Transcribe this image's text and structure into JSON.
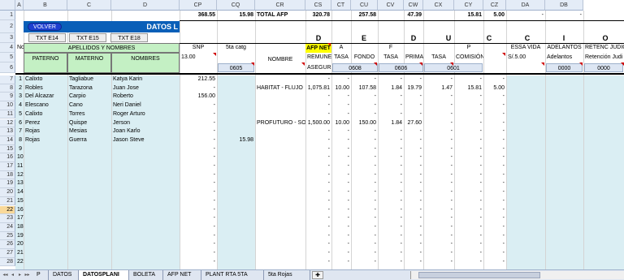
{
  "columns": [
    "A",
    "B",
    "C",
    "D",
    "CP",
    "CQ",
    "CR",
    "CS",
    "CT",
    "CU",
    "CV",
    "CW",
    "CX",
    "CY",
    "CZ",
    "DA",
    "DB"
  ],
  "row1": {
    "cp": "368.55",
    "cq": "15.98",
    "cr": "TOTAL AFP",
    "cs": "320.78",
    "cu": "257.58",
    "cw": "47.39",
    "cy": "15.81",
    "cz": "5.00",
    "da": "-",
    "db": "-"
  },
  "row2": {
    "volver": "VOLVER",
    "datos": "DATOS L"
  },
  "row3": {
    "txt14": "TXT E14",
    "txt15": "TXT E15",
    "txt18": "TXT E18",
    "letters": [
      "D",
      "E",
      "D",
      "U",
      "C",
      "C",
      "I",
      "O"
    ]
  },
  "row4": {
    "no": "No",
    "apellidos": "APELLIDOS Y NOMBRES",
    "snp": "SNP",
    "catg": "5ta catg",
    "afpnet": "AFP NET",
    "a": "A",
    "f": "F",
    "p": "P",
    "essa": "ESSA VIDA",
    "adel": "ADELANTOS",
    "reten": "RETENC JUDIC"
  },
  "row5": {
    "paterno": "PATERNO",
    "materno": "MATERNO",
    "nombres": "NOMBRES",
    "snpval": "13.00",
    "nombre": "NOMBRE",
    "remuner": "REMUNER",
    "tasa1": "TASA",
    "fondo": "FONDO",
    "tasa2": "TASA",
    "prima": "PRIMA",
    "tasa3": "TASA",
    "comision": "COMISIÓN",
    "essaval": "S/.5.00",
    "adelantos": "Adelantos",
    "retencion": "Retención Judi"
  },
  "row6": {
    "cq": "0605",
    "asegur": "ASEGUR",
    "cu": "0608",
    "cw": "0606",
    "cy": "0601",
    "da": "0000",
    "db": "0000"
  },
  "rows": [
    {
      "n": "1",
      "pat": "Calixto",
      "mat": "Tagliabue",
      "nom": "Katya Karin",
      "snp": "212.55",
      "catg": "",
      "afp": "",
      "rem": "-",
      "t1": "-",
      "fon": "-",
      "t2": "-",
      "pri": "-",
      "t3": "-",
      "com": "-",
      "ess": "-"
    },
    {
      "n": "2",
      "pat": "Robles",
      "mat": "Tarazona",
      "nom": "Juan Jose",
      "snp": "-",
      "catg": "",
      "afp": "HABITAT - FLUJO",
      "rem": "1,075.81",
      "t1": "10.00",
      "fon": "107.58",
      "t2": "1.84",
      "pri": "19.79",
      "t3": "1.47",
      "com": "15.81",
      "ess": "5.00"
    },
    {
      "n": "3",
      "pat": "Del Alcazar",
      "mat": "Carpio",
      "nom": "Roberto",
      "snp": "156.00",
      "catg": "",
      "afp": "",
      "rem": "-",
      "t1": "-",
      "fon": "-",
      "t2": "-",
      "pri": "-",
      "t3": "-",
      "com": "-",
      "ess": "-"
    },
    {
      "n": "4",
      "pat": "Elescano",
      "mat": "Cano",
      "nom": "Neri Daniel",
      "snp": "-",
      "catg": "",
      "afp": "",
      "rem": "-",
      "t1": "-",
      "fon": "-",
      "t2": "-",
      "pri": "-",
      "t3": "-",
      "com": "-",
      "ess": "-"
    },
    {
      "n": "5",
      "pat": "Calixto",
      "mat": "Torres",
      "nom": "Roger Arturo",
      "snp": "-",
      "catg": "",
      "afp": "",
      "rem": "-",
      "t1": "-",
      "fon": "-",
      "t2": "-",
      "pri": "-",
      "t3": "-",
      "com": "-",
      "ess": "-"
    },
    {
      "n": "6",
      "pat": "Perez",
      "mat": "Quispe",
      "nom": "Jerson",
      "snp": "-",
      "catg": "",
      "afp": "PROFUTURO - SOB",
      "rem": "1,500.00",
      "t1": "10.00",
      "fon": "150.00",
      "t2": "1.84",
      "pri": "27.60",
      "t3": "-",
      "com": "-",
      "ess": "-"
    },
    {
      "n": "7",
      "pat": "Rojas",
      "mat": "Mesias",
      "nom": "Joan Karlo",
      "snp": "-",
      "catg": "",
      "afp": "",
      "rem": "-",
      "t1": "-",
      "fon": "-",
      "t2": "-",
      "pri": "-",
      "t3": "-",
      "com": "-",
      "ess": "-"
    },
    {
      "n": "8",
      "pat": "Rojas",
      "mat": "Guerra",
      "nom": "Jason Steve",
      "snp": "-",
      "catg": "15.98",
      "afp": "",
      "rem": "-",
      "t1": "-",
      "fon": "-",
      "t2": "-",
      "pri": "-",
      "t3": "-",
      "com": "-",
      "ess": "-"
    },
    {
      "n": "9",
      "pat": "",
      "mat": "",
      "nom": "",
      "snp": "-",
      "catg": "",
      "afp": "",
      "rem": "-",
      "t1": "-",
      "fon": "-",
      "t2": "-",
      "pri": "-",
      "t3": "-",
      "com": "-",
      "ess": "-"
    },
    {
      "n": "10",
      "pat": "",
      "mat": "",
      "nom": "",
      "snp": "-",
      "catg": "",
      "afp": "",
      "rem": "-",
      "t1": "-",
      "fon": "-",
      "t2": "-",
      "pri": "-",
      "t3": "-",
      "com": "-",
      "ess": "-"
    },
    {
      "n": "11",
      "pat": "",
      "mat": "",
      "nom": "",
      "snp": "-",
      "catg": "",
      "afp": "",
      "rem": "-",
      "t1": "-",
      "fon": "-",
      "t2": "-",
      "pri": "-",
      "t3": "-",
      "com": "-",
      "ess": "-"
    },
    {
      "n": "12",
      "pat": "",
      "mat": "",
      "nom": "",
      "snp": "-",
      "catg": "",
      "afp": "",
      "rem": "-",
      "t1": "-",
      "fon": "-",
      "t2": "-",
      "pri": "-",
      "t3": "-",
      "com": "-",
      "ess": "-"
    },
    {
      "n": "13",
      "pat": "",
      "mat": "",
      "nom": "",
      "snp": "-",
      "catg": "",
      "afp": "",
      "rem": "-",
      "t1": "-",
      "fon": "-",
      "t2": "-",
      "pri": "-",
      "t3": "-",
      "com": "-",
      "ess": "-"
    },
    {
      "n": "14",
      "pat": "",
      "mat": "",
      "nom": "",
      "snp": "-",
      "catg": "",
      "afp": "",
      "rem": "-",
      "t1": "-",
      "fon": "-",
      "t2": "-",
      "pri": "-",
      "t3": "-",
      "com": "-",
      "ess": "-"
    },
    {
      "n": "15",
      "pat": "",
      "mat": "",
      "nom": "",
      "snp": "-",
      "catg": "",
      "afp": "",
      "rem": "-",
      "t1": "-",
      "fon": "-",
      "t2": "-",
      "pri": "-",
      "t3": "-",
      "com": "-",
      "ess": "-"
    },
    {
      "n": "16",
      "pat": "",
      "mat": "",
      "nom": "",
      "snp": "-",
      "catg": "",
      "afp": "",
      "rem": "-",
      "t1": "-",
      "fon": "-",
      "t2": "-",
      "pri": "-",
      "t3": "-",
      "com": "-",
      "ess": "-"
    },
    {
      "n": "17",
      "pat": "",
      "mat": "",
      "nom": "",
      "snp": "-",
      "catg": "",
      "afp": "",
      "rem": "-",
      "t1": "-",
      "fon": "-",
      "t2": "-",
      "pri": "-",
      "t3": "-",
      "com": "-",
      "ess": "-"
    },
    {
      "n": "18",
      "pat": "",
      "mat": "",
      "nom": "",
      "snp": "-",
      "catg": "",
      "afp": "",
      "rem": "-",
      "t1": "-",
      "fon": "-",
      "t2": "-",
      "pri": "-",
      "t3": "-",
      "com": "-",
      "ess": "-"
    },
    {
      "n": "19",
      "pat": "",
      "mat": "",
      "nom": "",
      "snp": "-",
      "catg": "",
      "afp": "",
      "rem": "-",
      "t1": "-",
      "fon": "-",
      "t2": "-",
      "pri": "-",
      "t3": "-",
      "com": "-",
      "ess": "-"
    },
    {
      "n": "20",
      "pat": "",
      "mat": "",
      "nom": "",
      "snp": "-",
      "catg": "",
      "afp": "",
      "rem": "-",
      "t1": "-",
      "fon": "-",
      "t2": "-",
      "pri": "-",
      "t3": "-",
      "com": "-",
      "ess": "-"
    },
    {
      "n": "21",
      "pat": "",
      "mat": "",
      "nom": "",
      "snp": "-",
      "catg": "",
      "afp": "",
      "rem": "-",
      "t1": "-",
      "fon": "-",
      "t2": "-",
      "pri": "-",
      "t3": "-",
      "com": "-",
      "ess": "-"
    },
    {
      "n": "22",
      "pat": "",
      "mat": "",
      "nom": "",
      "snp": "-",
      "catg": "",
      "afp": "",
      "rem": "-",
      "t1": "-",
      "fon": "-",
      "t2": "-",
      "pri": "-",
      "t3": "-",
      "com": "-",
      "ess": "-"
    }
  ],
  "row_headers": [
    "1",
    "2",
    "3",
    "4",
    "5",
    "6",
    "7",
    "8",
    "9",
    "10",
    "11",
    "12",
    "13",
    "14",
    "15",
    "16",
    "17",
    "18",
    "19",
    "20",
    "21",
    "22",
    "23",
    "24",
    "25",
    "26",
    "27",
    "28",
    "29",
    "30"
  ],
  "selected_row": "22",
  "tabs": [
    "P",
    "DATOS",
    "DATOSPLANI",
    "BOLETA",
    "AFP NET",
    "PLANT RTA 5TA",
    "5ta Rojas"
  ],
  "active_tab": "DATOSPLANI"
}
